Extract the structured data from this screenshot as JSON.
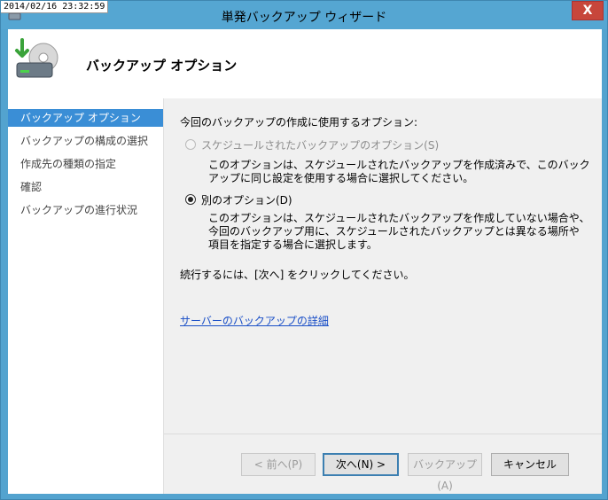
{
  "timestamp": "2014/02/16 23:32:59",
  "window": {
    "title": "単発バックアップ ウィザード",
    "close_glyph": "X"
  },
  "header": {
    "title": "バックアップ オプション"
  },
  "nav": {
    "items": [
      {
        "label": "バックアップ オプション",
        "active": true
      },
      {
        "label": "バックアップの構成の選択"
      },
      {
        "label": "作成先の種類の指定"
      },
      {
        "label": "確認"
      },
      {
        "label": "バックアップの進行状況"
      }
    ]
  },
  "content": {
    "prompt": "今回のバックアップの作成に使用するオプション:",
    "options": [
      {
        "label": "スケジュールされたバックアップのオプション(S)",
        "selected": false,
        "enabled": false,
        "description": [
          "このオプションは、スケジュールされたバックアップを作成済みで、このバック",
          "アップに同じ設定を使用する場合に選択してください。"
        ]
      },
      {
        "label": "別のオプション(D)",
        "selected": true,
        "enabled": true,
        "description": [
          "このオプションは、スケジュールされたバックアップを作成していない場合や、",
          "今回のバックアップ用に、スケジュールされたバックアップとは異なる場所や",
          "項目を指定する場合に選択します。"
        ]
      }
    ],
    "continue_text": "続行するには、[次へ] をクリックしてください。",
    "link": "サーバーのバックアップの詳細"
  },
  "buttons": {
    "back": "< 前へ(P)",
    "next": "次へ(N) >",
    "backup": "バックアップ(A)",
    "cancel": "キャンセル"
  },
  "colors": {
    "accent": "#3a8ed6",
    "title_bar": "#55a6d2",
    "link": "#1a4fc7"
  }
}
